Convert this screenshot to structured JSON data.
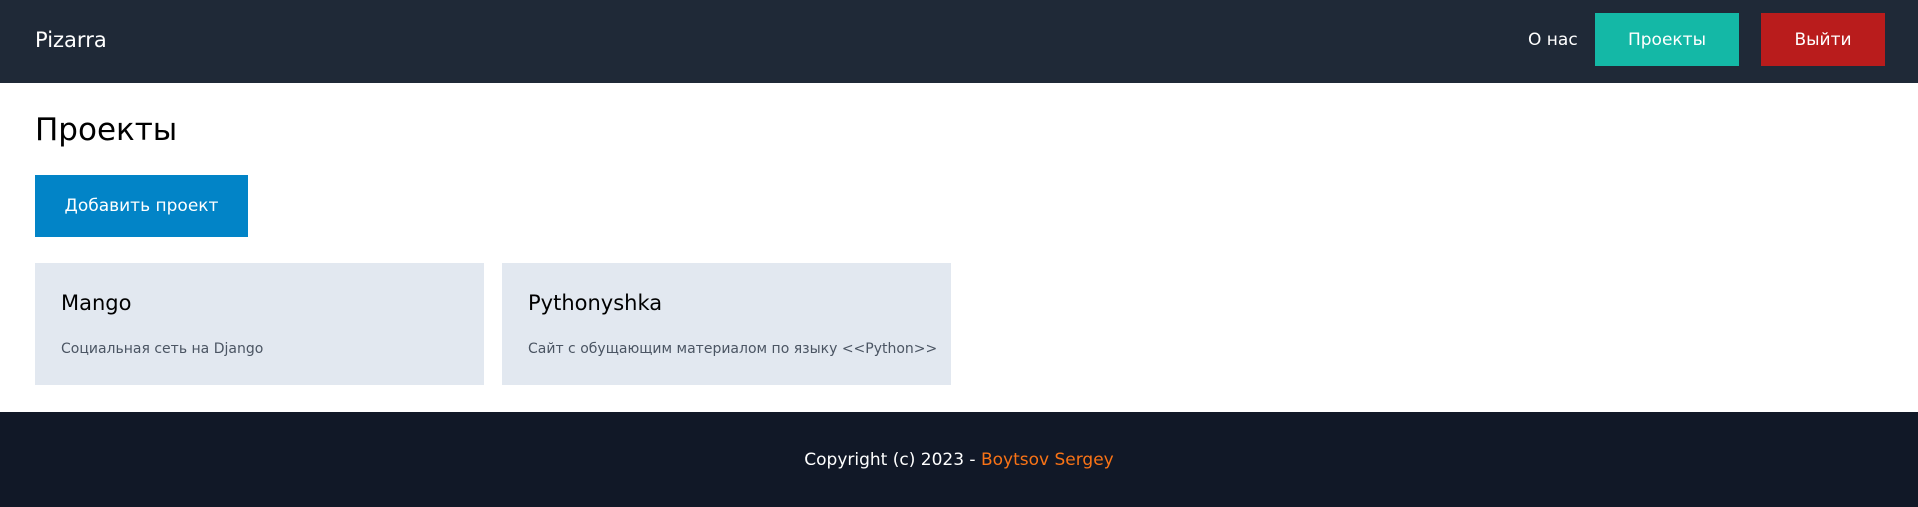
{
  "header": {
    "brand": "Pizarra",
    "nav": {
      "about_label": "О нас",
      "projects_label": "Проекты",
      "logout_label": "Выйти"
    }
  },
  "main": {
    "title": "Проекты",
    "add_project_label": "Добавить проект",
    "projects": [
      {
        "title": "Mango",
        "description": "Социальная сеть на Django"
      },
      {
        "title": "Pythonyshka",
        "description": "Сайт с обущающим материалом по языку <<Python>>"
      }
    ]
  },
  "footer": {
    "copyright": "Copyright (c) 2023 - ",
    "author": "Boytsov Sergey"
  },
  "colors": {
    "navbar_bg": "#1f2937",
    "projects_button": "#14b8a6",
    "logout_button": "#b91c1c",
    "add_button": "#0284c7",
    "card_bg": "#e2e8f0",
    "footer_bg": "#111827",
    "footer_link": "#f97316"
  }
}
